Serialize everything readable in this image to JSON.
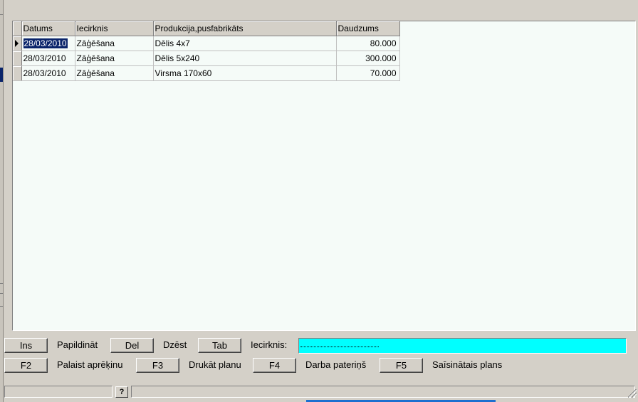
{
  "grid": {
    "columns": [
      "Datums",
      "Iecirknis",
      "Produkcija,pusfabrikāts",
      "Daudzums"
    ],
    "rows": [
      {
        "date": "28/03/2010",
        "section": "Zāģēšana",
        "product": "Dēlis 4x7",
        "qty": "80.000"
      },
      {
        "date": "28/03/2010",
        "section": "Zāģēšana",
        "product": "Dēlis 5x240",
        "qty": "300.000"
      },
      {
        "date": "28/03/2010",
        "section": "Zāģēšana",
        "product": "Virsma 170x60",
        "qty": "70.000"
      }
    ]
  },
  "actions": {
    "ins_key": "Ins",
    "ins_label": "Papildināt",
    "del_key": "Del",
    "del_label": "Dzēst",
    "tab_key": "Tab",
    "tab_label": "Iecirknis:",
    "f2_key": "F2",
    "f2_label": "Palaist aprēķinu",
    "f3_key": "F3",
    "f3_label": "Drukāt planu",
    "f4_key": "F4",
    "f4_label": "Darba pateriņš",
    "f5_key": "F5",
    "f5_label": "Saīsinātais plans"
  },
  "section_field": {
    "value": ""
  },
  "status": {
    "help_label": "?"
  },
  "colors": {
    "window": "#d4d0c8",
    "grid_bg": "#f5fbf8",
    "field": "#00ffff",
    "selection": "#0a246a"
  }
}
